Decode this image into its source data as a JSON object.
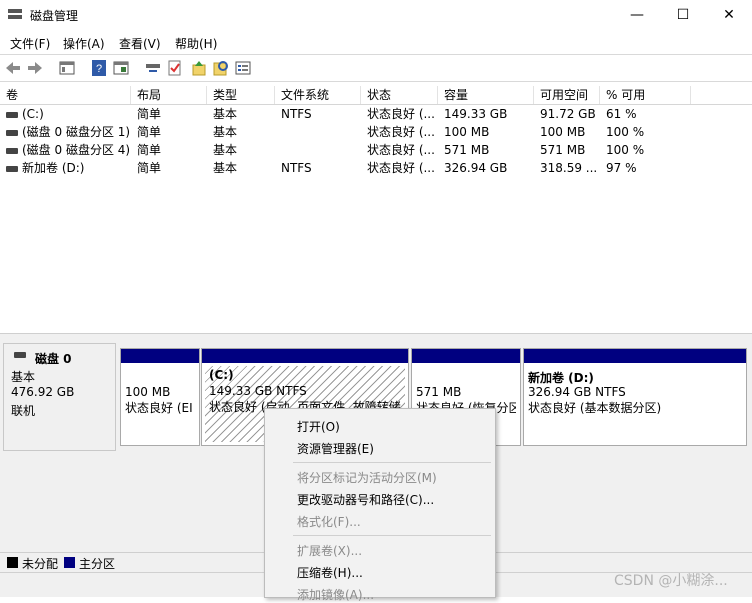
{
  "window": {
    "title": "磁盘管理",
    "minimize_icon": "—",
    "maximize_icon": "☐",
    "close_icon": "✕"
  },
  "menu": [
    "文件(F)",
    "操作(A)",
    "查看(V)",
    "帮助(H)"
  ],
  "toolbar": {
    "icons": [
      "back-arrow-icon",
      "forward-arrow-icon",
      "properties-icon",
      "help-icon",
      "view-icon",
      "connect-icon",
      "check-icon",
      "up-icon",
      "search-icon",
      "view-list-icon"
    ],
    "help_glyph": "?"
  },
  "columns": [
    "卷",
    "布局",
    "类型",
    "文件系统",
    "状态",
    "容量",
    "可用空间",
    "% 可用"
  ],
  "volumes": [
    {
      "name": "(C:)",
      "layout": "简单",
      "type": "基本",
      "fs": "NTFS",
      "status": "状态良好 (...",
      "capacity": "149.33 GB",
      "free": "91.72 GB",
      "pct": "61 %"
    },
    {
      "name": "(磁盘 0 磁盘分区 1)",
      "layout": "简单",
      "type": "基本",
      "fs": "",
      "status": "状态良好 (...",
      "capacity": "100 MB",
      "free": "100 MB",
      "pct": "100 %"
    },
    {
      "name": "(磁盘 0 磁盘分区 4)",
      "layout": "简单",
      "type": "基本",
      "fs": "",
      "status": "状态良好 (...",
      "capacity": "571 MB",
      "free": "571 MB",
      "pct": "100 %"
    },
    {
      "name": "新加卷 (D:)",
      "layout": "简单",
      "type": "基本",
      "fs": "NTFS",
      "status": "状态良好 (...",
      "capacity": "326.94 GB",
      "free": "318.59 ...",
      "pct": "97 %"
    }
  ],
  "disk": {
    "name": "磁盘 0",
    "type": "基本",
    "size": "476.92 GB",
    "state": "联机"
  },
  "partitions": [
    {
      "title": "",
      "size": "100 MB",
      "status": "状态良好 (EI"
    },
    {
      "title": "(C:)",
      "size": "149.33 GB NTFS",
      "status": "状态良好 (启动, 页面文件, 故障转储"
    },
    {
      "title": "",
      "size": "571 MB",
      "status": "状态良好 (恢复分区"
    },
    {
      "title": "新加卷 (D:)",
      "size": "326.94 GB NTFS",
      "status": "状态良好 (基本数据分区)"
    }
  ],
  "legend": [
    {
      "label": "未分配",
      "color": "#000000"
    },
    {
      "label": "主分区",
      "color": "#000080"
    }
  ],
  "context_menu": [
    {
      "label": "打开(O)",
      "enabled": true
    },
    {
      "label": "资源管理器(E)",
      "enabled": true
    },
    {
      "label": "将分区标记为活动分区(M)",
      "enabled": false
    },
    {
      "label": "更改驱动器号和路径(C)...",
      "enabled": true
    },
    {
      "label": "格式化(F)...",
      "enabled": false
    },
    {
      "label": "扩展卷(X)...",
      "enabled": false
    },
    {
      "label": "压缩卷(H)...",
      "enabled": true
    },
    {
      "label": "添加镜像(A)...",
      "enabled": false
    }
  ],
  "watermark": "CSDN @小糊涂..."
}
